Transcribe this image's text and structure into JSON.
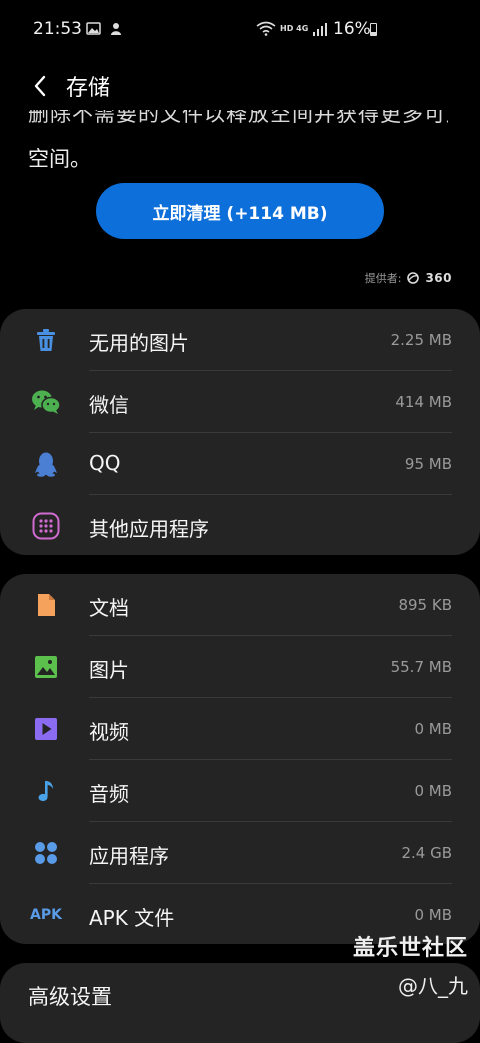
{
  "status": {
    "time": "21:53",
    "network": "HD 4G",
    "battery": "16%"
  },
  "header": {
    "title": "存储"
  },
  "partial_desc_visible": "删除不需要的文件以释放空间并获得更多可用",
  "desc_tail": "空间。",
  "clean_button": {
    "label": "立即清理 (+114 MB)"
  },
  "provider": {
    "label": "提供者:",
    "brand": "360"
  },
  "cleanup_items": [
    {
      "label": "无用的图片",
      "size": "2.25 MB",
      "icon": "trash-icon",
      "color": "#4a90e2"
    },
    {
      "label": "微信",
      "size": "414 MB",
      "icon": "wechat-icon",
      "color": "#4caf50"
    },
    {
      "label": "QQ",
      "size": "95 MB",
      "icon": "qq-penguin-icon",
      "color": "#4a7fd4"
    },
    {
      "label": "其他应用程序",
      "size": "",
      "icon": "apps-grid-icon",
      "color": "#d06bd0"
    }
  ],
  "category_items": [
    {
      "label": "文档",
      "size": "895 KB",
      "icon": "document-icon",
      "color": "#f5a25d"
    },
    {
      "label": "图片",
      "size": "55.7 MB",
      "icon": "image-icon",
      "color": "#5cc04c"
    },
    {
      "label": "视频",
      "size": "0 MB",
      "icon": "video-icon",
      "color": "#8b6cf0"
    },
    {
      "label": "音频",
      "size": "0 MB",
      "icon": "music-icon",
      "color": "#4aa3e8"
    },
    {
      "label": "应用程序",
      "size": "2.4 GB",
      "icon": "apps-dots-icon",
      "color": "#5a9be8"
    },
    {
      "label": "APK 文件",
      "size": "0 MB",
      "icon": "apk-icon",
      "color": "#5a9be8",
      "icon_text": "APK"
    }
  ],
  "advanced": {
    "label": "高级设置"
  },
  "watermark": {
    "title": "盖乐世社区",
    "user": "@八_九"
  }
}
